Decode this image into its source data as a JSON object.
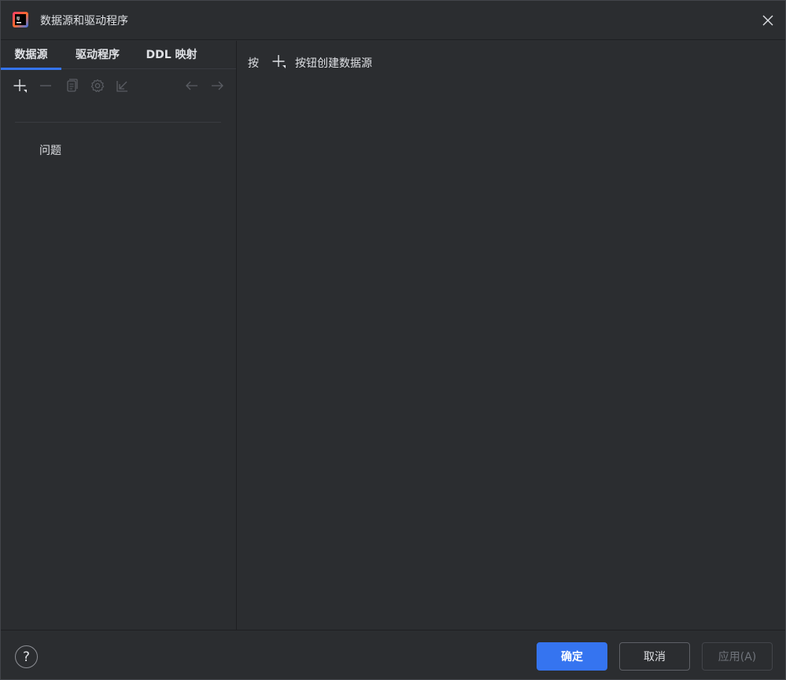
{
  "window": {
    "title": "数据源和驱动程序"
  },
  "tabs": [
    {
      "label": "数据源",
      "active": true
    },
    {
      "label": "驱动程序",
      "active": false
    },
    {
      "label": "DDL 映射",
      "active": false
    }
  ],
  "toolbar": {
    "icons": [
      "add-icon",
      "remove-icon",
      "duplicate-icon",
      "settings-icon",
      "import-icon",
      "back-arrow-icon",
      "forward-arrow-icon"
    ]
  },
  "left_panel": {
    "problems_label": "问题"
  },
  "right_panel": {
    "hint_prefix": "按",
    "hint_suffix": "按钮创建数据源"
  },
  "footer": {
    "help_label": "?",
    "ok_label": "确定",
    "cancel_label": "取消",
    "apply_label": "应用(A)"
  },
  "colors": {
    "background": "#2b2d30",
    "accent": "#3574f0",
    "text": "#dfe1e5",
    "disabled_text": "#6f737a"
  }
}
